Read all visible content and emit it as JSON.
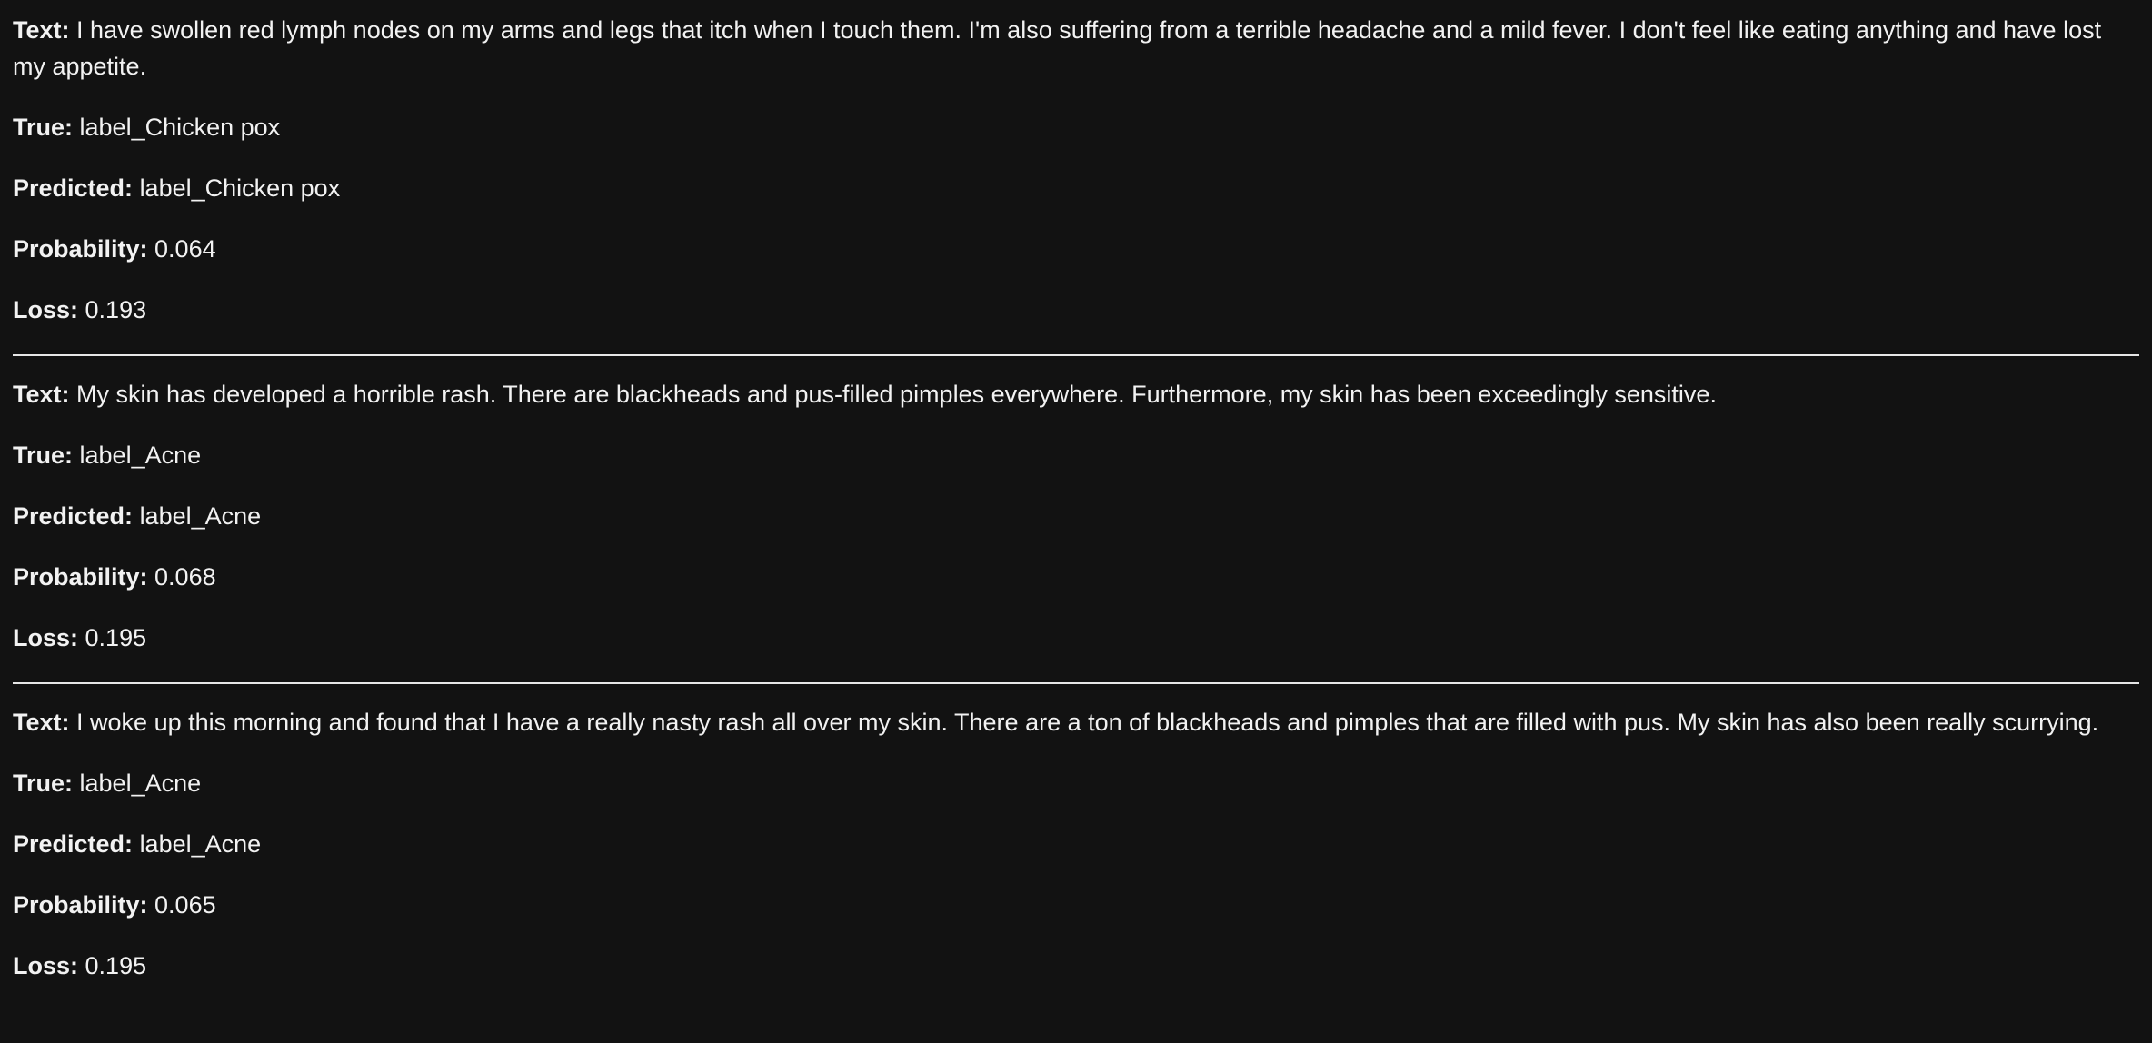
{
  "field_labels": {
    "text": "Text:",
    "true": "True:",
    "predicted": "Predicted:",
    "probability": "Probability:",
    "loss": "Loss:"
  },
  "records": [
    {
      "text": "I have swollen red lymph nodes on my arms and legs that itch when I touch them. I'm also suffering from a terrible headache and a mild fever. I don't feel like eating anything and have lost my appetite.",
      "true": "label_Chicken pox",
      "predicted": "label_Chicken pox",
      "probability": "0.064",
      "loss": "0.193"
    },
    {
      "text": "My skin has developed a horrible rash. There are blackheads and pus-filled pimples everywhere. Furthermore, my skin has been exceedingly sensitive.",
      "true": "label_Acne",
      "predicted": "label_Acne",
      "probability": "0.068",
      "loss": "0.195"
    },
    {
      "text": "I woke up this morning and found that I have a really nasty rash all over my skin. There are a ton of blackheads and pimples that are filled with pus. My skin has also been really scurrying.",
      "true": "label_Acne",
      "predicted": "label_Acne",
      "probability": "0.065",
      "loss": "0.195"
    }
  ]
}
